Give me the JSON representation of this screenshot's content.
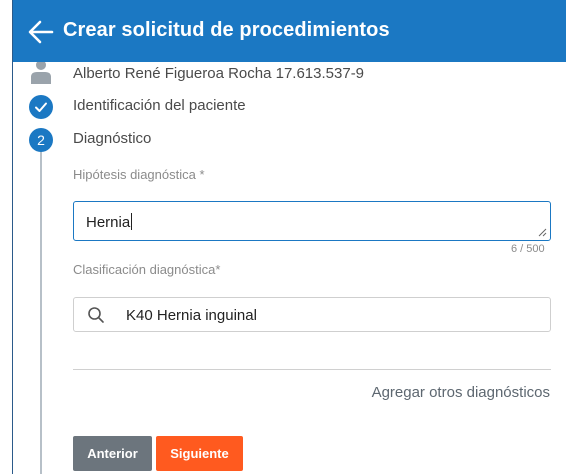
{
  "header": {
    "title": "Crear solicitud de procedimientos",
    "bg_color": "#1b78c3"
  },
  "patient": {
    "name_line": "Alberto René Figueroa Rocha 17.613.537-9",
    "icon": "user-icon"
  },
  "steps": [
    {
      "label": "Identificación del paciente",
      "state": "completed",
      "icon": "check-icon"
    },
    {
      "label": "Diagnóstico",
      "state": "active",
      "number": "2"
    }
  ],
  "form": {
    "hypothesis_label": "Hipótesis diagnóstica *",
    "hypothesis_value": "Hernia",
    "hypothesis_counter": "6 / 500",
    "classification_label": "Clasificación diagnóstica*",
    "classification_value": "K40 Hernia inguinal",
    "add_diagnoses_link": "Agregar otros diagnósticos"
  },
  "buttons": {
    "previous": "Anterior",
    "next": "Siguiente"
  },
  "colors": {
    "accent": "#1b78c3",
    "next_button": "#ff5a1f",
    "previous_button": "#6c757d"
  }
}
